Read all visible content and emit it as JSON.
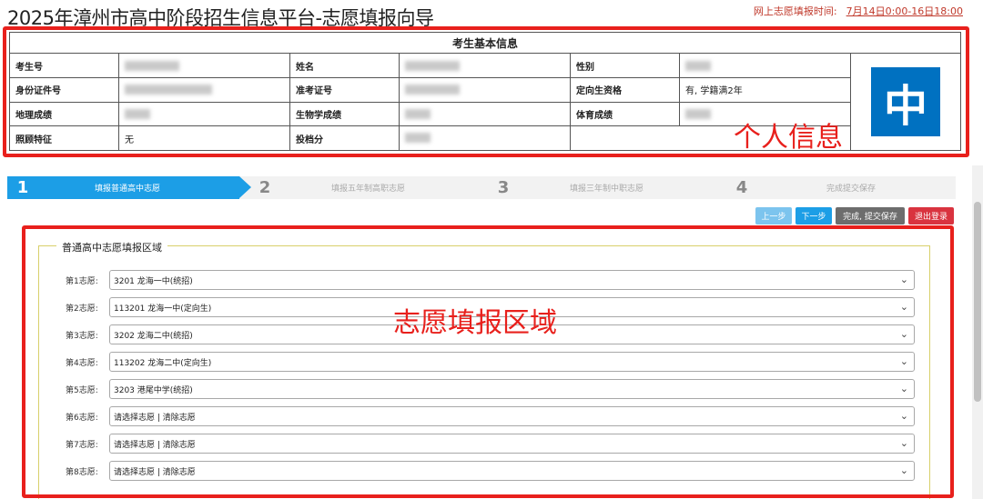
{
  "page": {
    "title": "2025年漳州市高中阶段招生信息平台-志愿填报向导",
    "time_label": "网上志愿填报时间:",
    "time_value": "7月14日0:00-16日18:00"
  },
  "student_info": {
    "header": "考生基本信息",
    "rows": [
      [
        {
          "label": "考生号",
          "value": ""
        },
        {
          "label": "姓名",
          "value": ""
        },
        {
          "label": "性别",
          "value": ""
        }
      ],
      [
        {
          "label": "身份证件号",
          "value": ""
        },
        {
          "label": "准考证号",
          "value": ""
        },
        {
          "label": "定向生资格",
          "value": "有, 学籍满2年"
        }
      ],
      [
        {
          "label": "地理成绩",
          "value": ""
        },
        {
          "label": "生物学成绩",
          "value": ""
        },
        {
          "label": "体育成绩",
          "value": ""
        }
      ],
      [
        {
          "label": "照顾特征",
          "value": "无"
        },
        {
          "label": "投档分",
          "value": ""
        },
        {
          "label": "",
          "value": ""
        }
      ]
    ],
    "photo_char": "中"
  },
  "annotations": {
    "personal": "个人信息",
    "volunteer": "志愿填报区域"
  },
  "steps": [
    {
      "num": "1",
      "label": "填报普通高中志愿"
    },
    {
      "num": "2",
      "label": "填报五年制高职志愿"
    },
    {
      "num": "3",
      "label": "填报三年制中职志愿"
    },
    {
      "num": "4",
      "label": "完成提交保存"
    }
  ],
  "buttons": {
    "prev": "上一步",
    "next": "下一步",
    "finish": "完成, 提交保存",
    "logout": "退出登录"
  },
  "fieldset": {
    "legend": "普通高中志愿填报区域"
  },
  "volunteers": [
    {
      "label": "第1志愿:",
      "value": "3201 龙海一中(统招)"
    },
    {
      "label": "第2志愿:",
      "value": "113201 龙海一中(定向生)"
    },
    {
      "label": "第3志愿:",
      "value": "3202 龙海二中(统招)"
    },
    {
      "label": "第4志愿:",
      "value": "113202 龙海二中(定向生)"
    },
    {
      "label": "第5志愿:",
      "value": "3203 港尾中学(统招)"
    },
    {
      "label": "第6志愿:",
      "value": "请选择志愿 | 清除志愿"
    },
    {
      "label": "第7志愿:",
      "value": "请选择志愿 | 清除志愿"
    },
    {
      "label": "第8志愿:",
      "value": "请选择志愿 | 清除志愿"
    }
  ],
  "colors": {
    "annotation_red": "#e8201c",
    "step_active_blue": "#1c9ee6",
    "photo_blue": "#0071c1",
    "logout_red": "#d9333f"
  }
}
